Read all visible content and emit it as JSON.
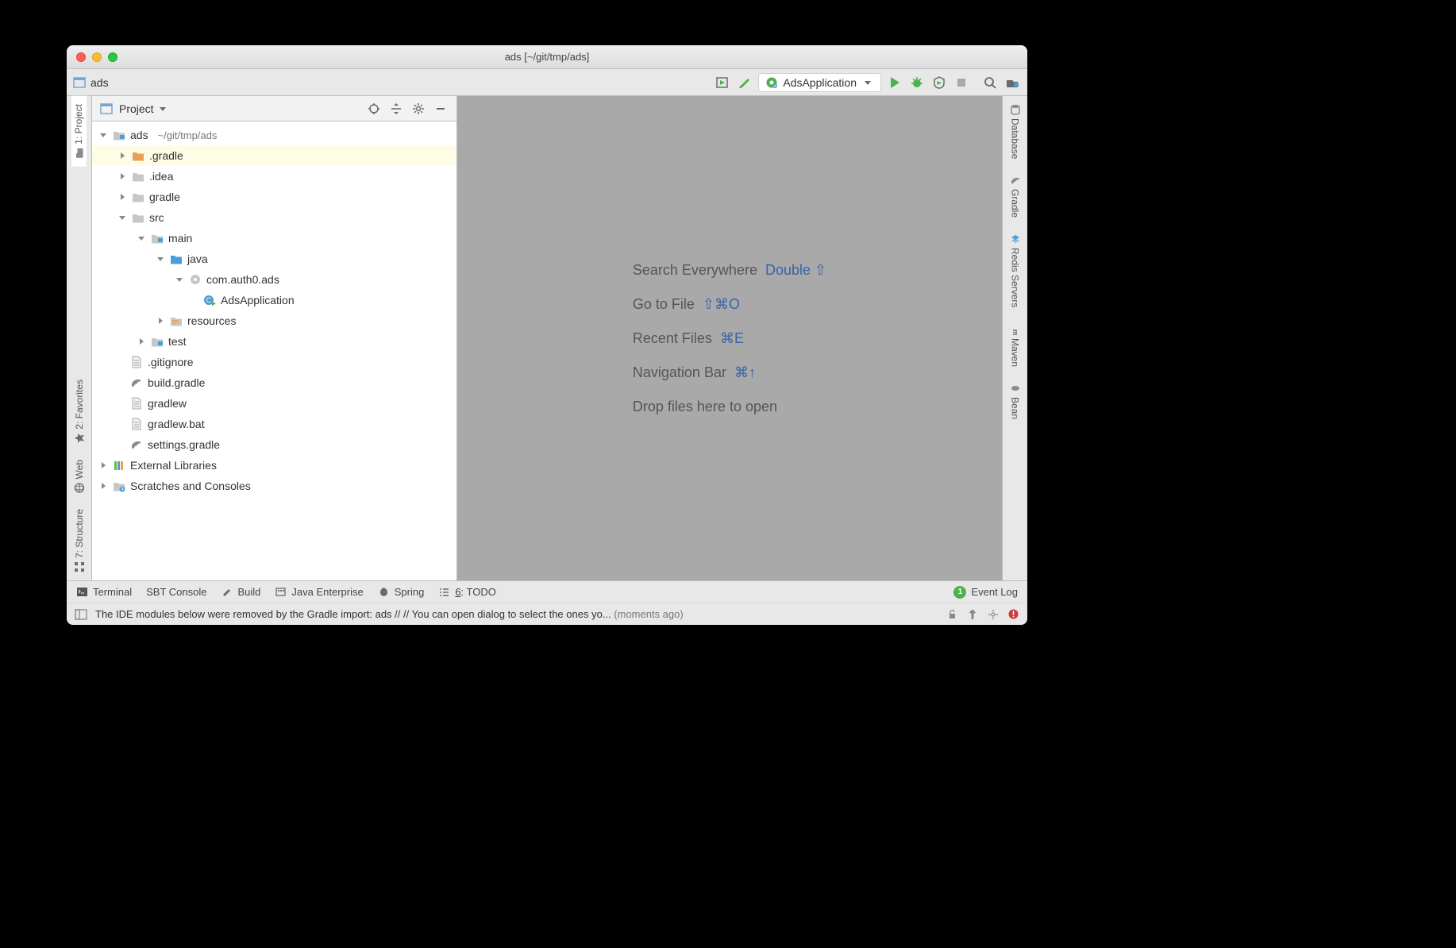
{
  "title": "ads [~/git/tmp/ads]",
  "breadcrumb": {
    "root": "ads"
  },
  "run_config": {
    "label": "AdsApplication"
  },
  "left_rail": {
    "project": "1: Project",
    "favorites": "2: Favorites",
    "web": "Web",
    "structure": "7: Structure"
  },
  "right_rail": {
    "database": "Database",
    "gradle": "Gradle",
    "redis": "Redis Servers",
    "maven": "Maven",
    "bean": "Bean"
  },
  "project_header": {
    "title": "Project"
  },
  "tree": {
    "root": {
      "name": "ads",
      "path": "~/git/tmp/ads"
    },
    "gradle_dot": ".gradle",
    "idea": ".idea",
    "gradle": "gradle",
    "src": "src",
    "main": "main",
    "java": "java",
    "pkg": "com.auth0.ads",
    "app": "AdsApplication",
    "resources": "resources",
    "test": "test",
    "gitignore": ".gitignore",
    "build_gradle": "build.gradle",
    "gradlew": "gradlew",
    "gradlew_bat": "gradlew.bat",
    "settings_gradle": "settings.gradle",
    "external_libraries": "External Libraries",
    "scratches": "Scratches and Consoles"
  },
  "hints": {
    "search": {
      "text": "Search Everywhere",
      "shortcut": "Double ⇧"
    },
    "goto_file": {
      "text": "Go to File",
      "shortcut": "⇧⌘O"
    },
    "recent": {
      "text": "Recent Files",
      "shortcut": "⌘E"
    },
    "navbar": {
      "text": "Navigation Bar",
      "shortcut": "⌘↑"
    },
    "drop": {
      "text": "Drop files here to open"
    }
  },
  "bottom_tabs": {
    "terminal": "Terminal",
    "sbt": "SBT Console",
    "build": "Build",
    "javaee": "Java Enterprise",
    "spring": "Spring",
    "todo": "6: TODO",
    "event_log": "Event Log",
    "event_badge": "1"
  },
  "status": {
    "msg": "The IDE modules below were removed by the Gradle import: ads // // You can open dialog to select the ones yo...",
    "time": "(moments ago)"
  }
}
